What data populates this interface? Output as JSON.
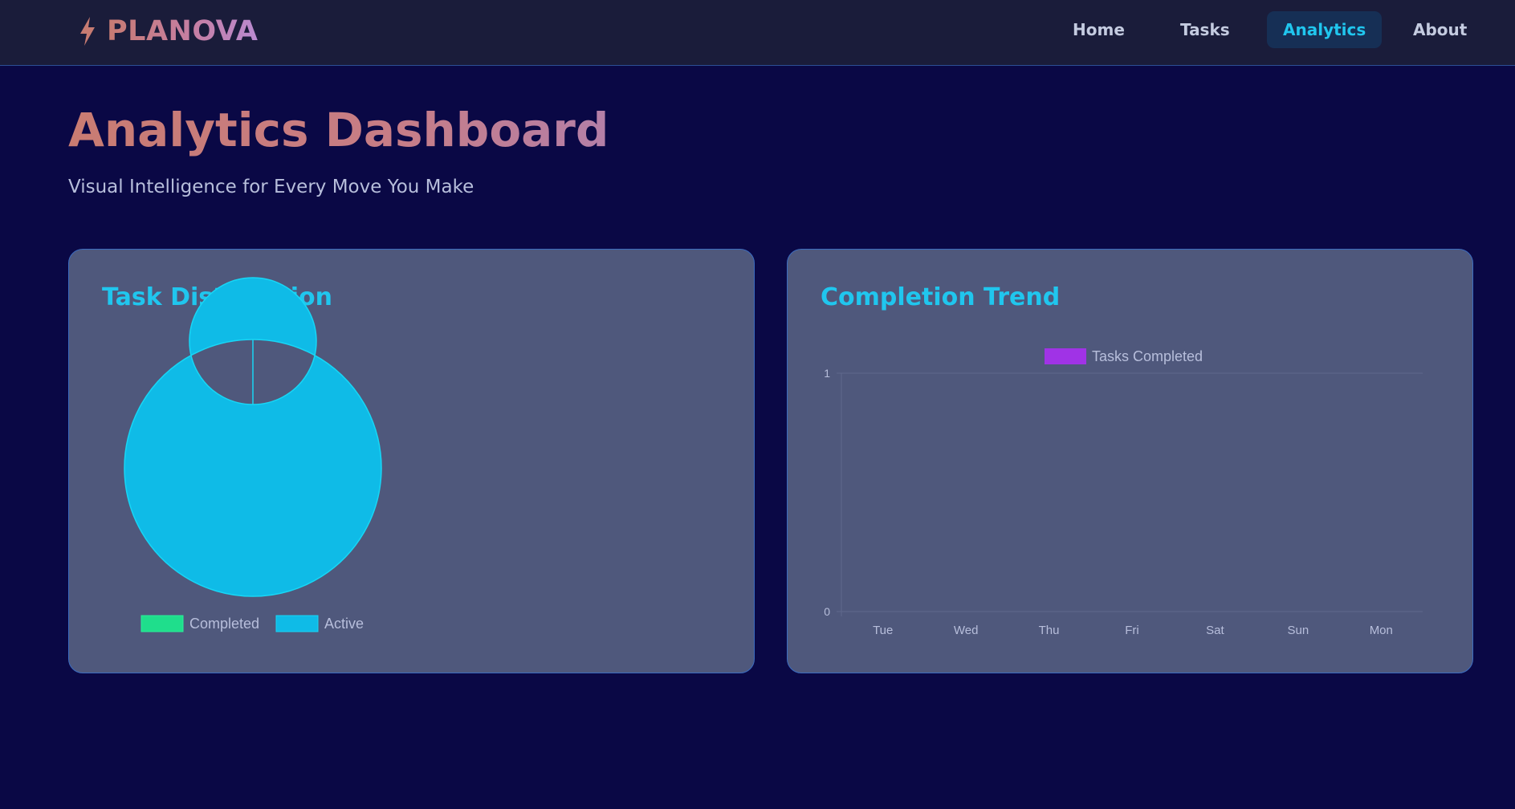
{
  "app": {
    "brand_name": "PLANOVA",
    "brand_icon": "lightning-bolt-icon"
  },
  "nav": {
    "items": [
      {
        "label": "Home",
        "active": false
      },
      {
        "label": "Tasks",
        "active": false
      },
      {
        "label": "Analytics",
        "active": true
      },
      {
        "label": "About",
        "active": false
      }
    ]
  },
  "header": {
    "title": "Analytics Dashboard",
    "subtitle": "Visual Intelligence for Every Move You Make"
  },
  "cards": {
    "distribution_title": "Task Distribution",
    "trend_title": "Completion Trend"
  },
  "colors": {
    "background": "#0a0845",
    "navbar": "#1a1c3a",
    "card": "#4f587c",
    "accent": "#20c6ee",
    "completed": "#1fde8c",
    "active": "#0fbbe7",
    "trend_series": "#a033e6"
  },
  "chart_data": [
    {
      "type": "pie",
      "variant": "doughnut",
      "labels": [
        "Completed",
        "Active"
      ],
      "values": [
        0,
        1
      ],
      "colors": [
        "#1fde8c",
        "#0fbbe7"
      ],
      "legend": "bottom"
    },
    {
      "type": "line",
      "categories": [
        "Tue",
        "Wed",
        "Thu",
        "Fri",
        "Sat",
        "Sun",
        "Mon"
      ],
      "series": [
        {
          "name": "Tasks Completed",
          "values": [
            0,
            0,
            0,
            0,
            0,
            0,
            0
          ],
          "color": "#a033e6"
        }
      ],
      "ylim": [
        0,
        1
      ],
      "yticks": [
        "0",
        "1"
      ],
      "grid": true,
      "legend": "top"
    }
  ]
}
